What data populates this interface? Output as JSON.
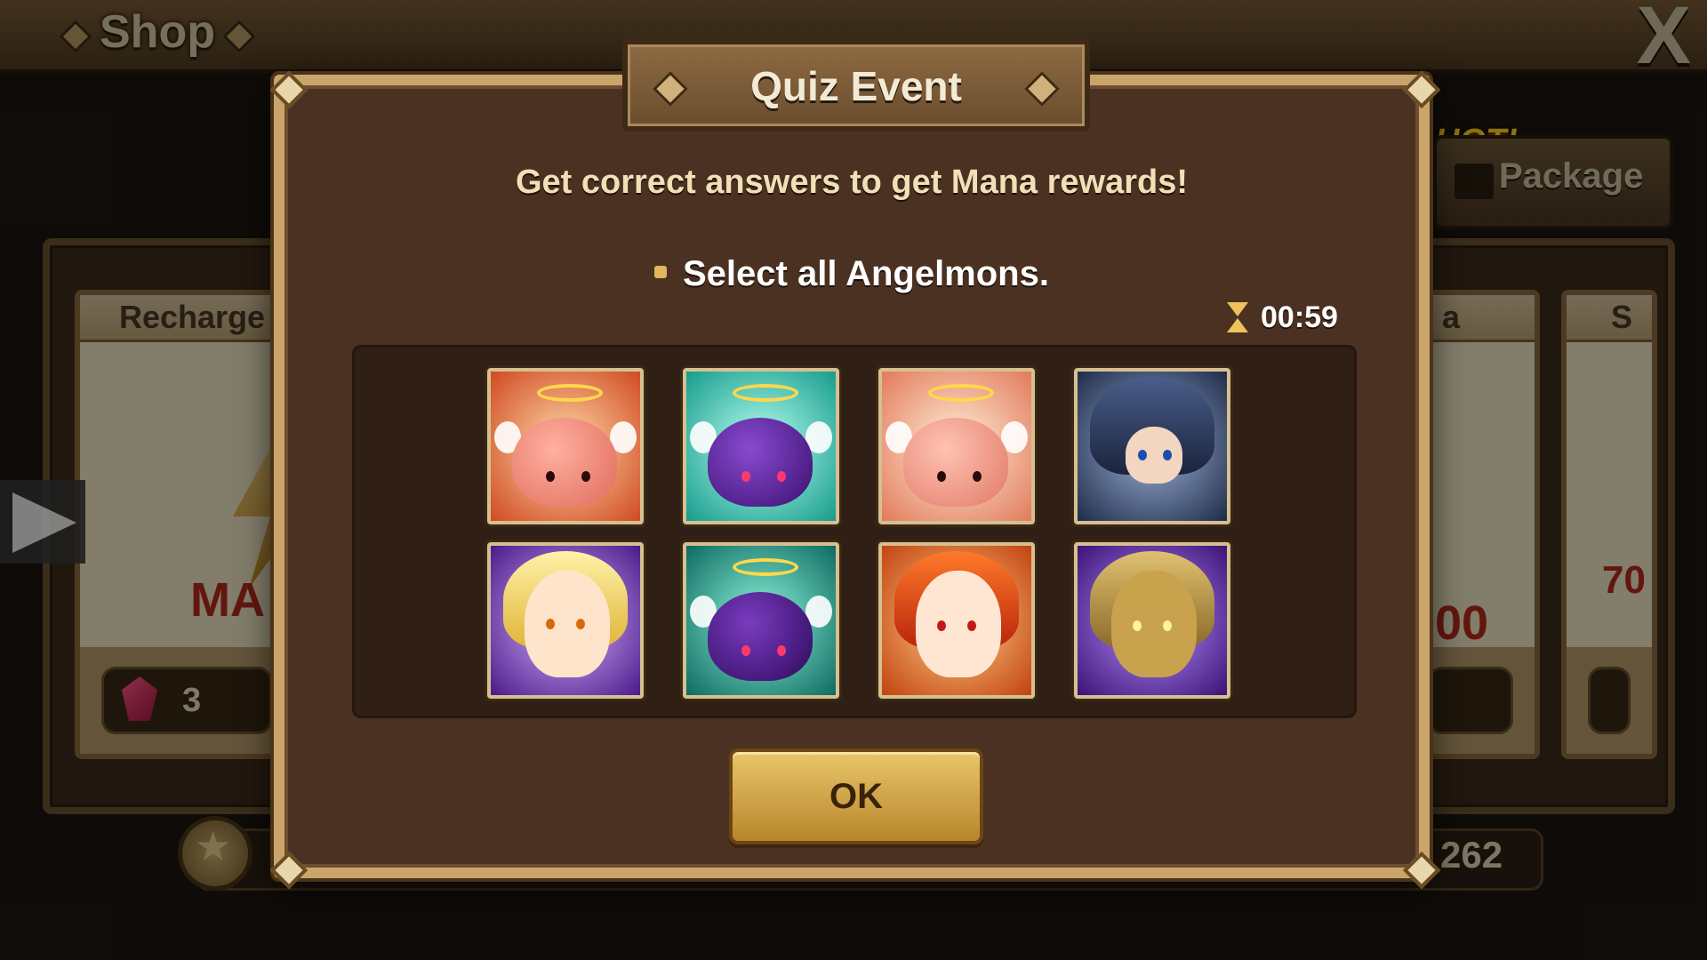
{
  "background": {
    "shop_title": "Shop",
    "left_card_header": "Recharge",
    "left_card_big_text": "MA",
    "left_card_price": "3",
    "right_card_header": "a",
    "right_card_big_text": "00",
    "far_card_header": "S",
    "far_card_big_text": "70",
    "hot_badge": "HOT!",
    "package_tab": "Package",
    "bottom_count": "262"
  },
  "modal": {
    "title": "Quiz Event",
    "subtitle": "Get correct answers to get Mana rewards!",
    "question": "Select all Angelmons.",
    "timer": "00:59",
    "ok_label": "OK",
    "tiles": [
      {
        "monster": "angelmon-fire"
      },
      {
        "monster": "angelmon-dark"
      },
      {
        "monster": "angelmon-fire-alt"
      },
      {
        "monster": "dark-knight"
      },
      {
        "monster": "light-fairy"
      },
      {
        "monster": "angelmon-dark-alt"
      },
      {
        "monster": "fire-girl"
      },
      {
        "monster": "gold-imp"
      }
    ]
  },
  "colors": {
    "modal_bg": "#4b3121",
    "modal_border": "#c9a56b",
    "ok_button": "#d9ae4e",
    "subtitle_text": "#f1dfb8"
  }
}
